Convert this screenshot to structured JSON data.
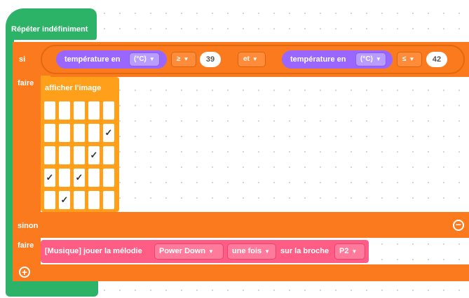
{
  "loop": {
    "label": "Répéter indéfiniment"
  },
  "ifelse": {
    "if_label": "si",
    "then_label": "faire",
    "else_label": "sinon",
    "else_then_label": "faire"
  },
  "condition": {
    "left": {
      "sensor": "température en",
      "unit": "(°C)",
      "operator": "≥",
      "value": "39"
    },
    "join": "et",
    "right": {
      "sensor": "température en",
      "unit": "(°C)",
      "operator": "≤",
      "value": "42"
    }
  },
  "show_image": {
    "label": "afficher l'image",
    "grid": [
      [
        0,
        0,
        0,
        0,
        0
      ],
      [
        0,
        0,
        0,
        0,
        1
      ],
      [
        0,
        0,
        0,
        1,
        0
      ],
      [
        1,
        0,
        1,
        0,
        0
      ],
      [
        0,
        1,
        0,
        0,
        0
      ]
    ],
    "check_symbol": "✓"
  },
  "music": {
    "label": "[Musique] jouer la mélodie",
    "melody": "Power Down",
    "repeat": "une fois",
    "pin_label": "sur la broche",
    "pin": "P2"
  },
  "buttons": {
    "remove": "−",
    "add": "+"
  },
  "icons": {
    "dropdown": "caret-down-icon",
    "remove": "minus-circle-icon",
    "add": "plus-circle-icon"
  },
  "colors": {
    "loop": "#2db367",
    "control": "#fc7a1e",
    "sensor": "#9966ff",
    "image_block": "#ff9f1a",
    "music_block": "#ff5d86"
  }
}
